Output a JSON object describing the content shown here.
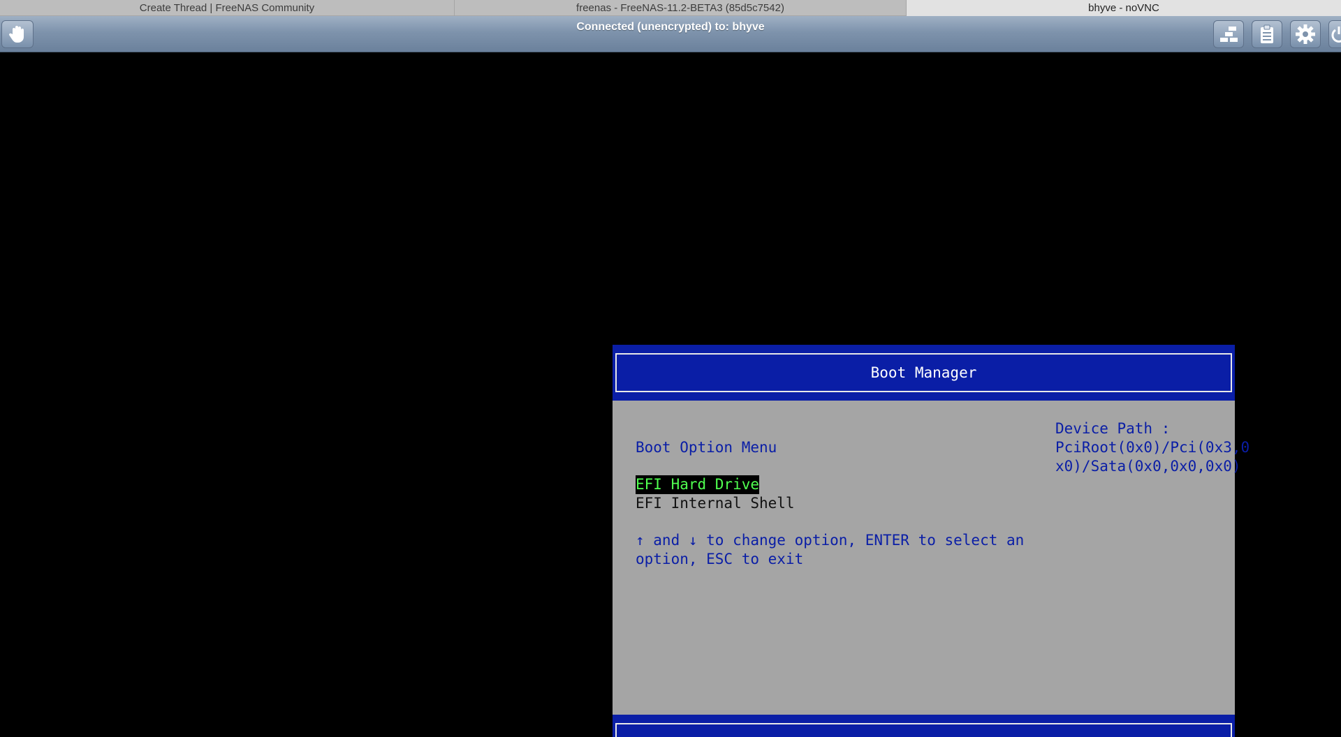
{
  "browser": {
    "tabs": [
      {
        "label": "Create Thread | FreeNAS Community",
        "active": false
      },
      {
        "label": "freenas - FreeNAS-11.2-BETA3 (85d5c7542)",
        "active": false
      },
      {
        "label": "bhyve - noVNC",
        "active": true
      }
    ]
  },
  "vnc": {
    "status": "Connected (unencrypted) to: bhyve",
    "buttons": {
      "drag": "hand-icon",
      "extra_keys": "keys-icon",
      "clipboard": "clipboard-icon",
      "settings": "gear-icon",
      "disconnect": "power-icon"
    }
  },
  "bios": {
    "title": "Boot Manager",
    "menu_title": "Boot Option Menu",
    "options": [
      "EFI Hard Drive",
      "EFI Internal Shell"
    ],
    "selected_index": 0,
    "help_line1": "↑ and ↓ to change option, ENTER to select an",
    "help_line2": "option, ESC to exit",
    "device_path_label": "Device Path :",
    "device_path_line1": "PciRoot(0x0)/Pci(0x3,0",
    "device_path_line2": "x0)/Sata(0x0,0x0,0x0)",
    "colors": {
      "header_blue": "#0a1ea6",
      "body_gray": "#a5a5a5",
      "selected_text": "#50ff50"
    }
  }
}
